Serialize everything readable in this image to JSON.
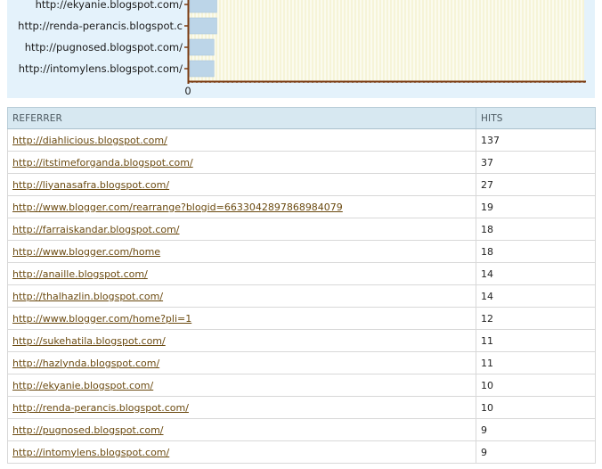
{
  "chart_data": {
    "type": "bar",
    "orientation": "horizontal",
    "categories": [
      "http://ekyanie.blogspot.com/",
      "http://renda-perancis.blogspot.c",
      "http://pugnosed.blogspot.com/",
      "http://intomylens.blogspot.com/"
    ],
    "values": [
      10,
      10,
      9,
      9
    ],
    "xlim": [
      0,
      137
    ],
    "x_tick_labels": [
      "0"
    ],
    "grid": true,
    "bar_color": "#bcd5e8",
    "axis_color": "#7a3a10",
    "grid_color": "#f1eec2",
    "title": "",
    "xlabel": "",
    "ylabel": ""
  },
  "table": {
    "headers": {
      "referrer": "REFERRER",
      "hits": "HITS"
    },
    "rows": [
      {
        "url": "http://diahlicious.blogspot.com/",
        "hits": "137"
      },
      {
        "url": "http://itstimeforganda.blogspot.com/",
        "hits": "37"
      },
      {
        "url": "http://liyanasafra.blogspot.com/",
        "hits": "27"
      },
      {
        "url": "http://www.blogger.com/rearrange?blogid=6633042897868984079",
        "hits": "19"
      },
      {
        "url": "http://farraiskandar.blogspot.com/",
        "hits": "18"
      },
      {
        "url": "http://www.blogger.com/home",
        "hits": "18"
      },
      {
        "url": "http://anaille.blogspot.com/",
        "hits": "14"
      },
      {
        "url": "http://thalhazlin.blogspot.com/",
        "hits": "14"
      },
      {
        "url": "http://www.blogger.com/home?pli=1",
        "hits": "12"
      },
      {
        "url": "http://sukehatila.blogspot.com/",
        "hits": "11"
      },
      {
        "url": "http://hazlynda.blogspot.com/",
        "hits": "11"
      },
      {
        "url": "http://ekyanie.blogspot.com/",
        "hits": "10"
      },
      {
        "url": "http://renda-perancis.blogspot.com/",
        "hits": "10"
      },
      {
        "url": "http://pugnosed.blogspot.com/",
        "hits": "9"
      },
      {
        "url": "http://intomylens.blogspot.com/",
        "hits": "9"
      }
    ]
  },
  "colors": {
    "chart_background": "#e4f2fb",
    "link": "#6b4a10",
    "header_background": "#d7e8f1"
  }
}
